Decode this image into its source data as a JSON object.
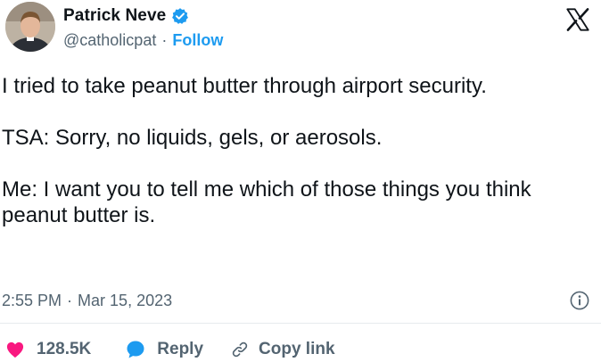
{
  "author": {
    "display_name": "Patrick Neve",
    "handle": "@catholicpat",
    "separator": "·",
    "follow_label": "Follow"
  },
  "tweet": {
    "paragraphs": [
      "I tried to take peanut butter through airport security.",
      "TSA: Sorry, no liquids, gels, or aerosols.",
      "Me: I want you to tell me which of those things you think peanut butter is."
    ],
    "time": "2:55 PM",
    "meta_separator": "·",
    "date": "Mar 15, 2023"
  },
  "actions": {
    "like_count": "128.5K",
    "reply_label": "Reply",
    "copy_link_label": "Copy link"
  },
  "icons": {
    "verified": "verified-badge-icon",
    "brand": "x-logo-icon",
    "info": "info-icon",
    "like": "heart-icon",
    "reply": "speech-bubble-icon",
    "copy": "link-icon"
  },
  "colors": {
    "accent": "#1d9bf0",
    "like": "#f91880",
    "text": "#0f1419",
    "secondary": "#536471"
  }
}
